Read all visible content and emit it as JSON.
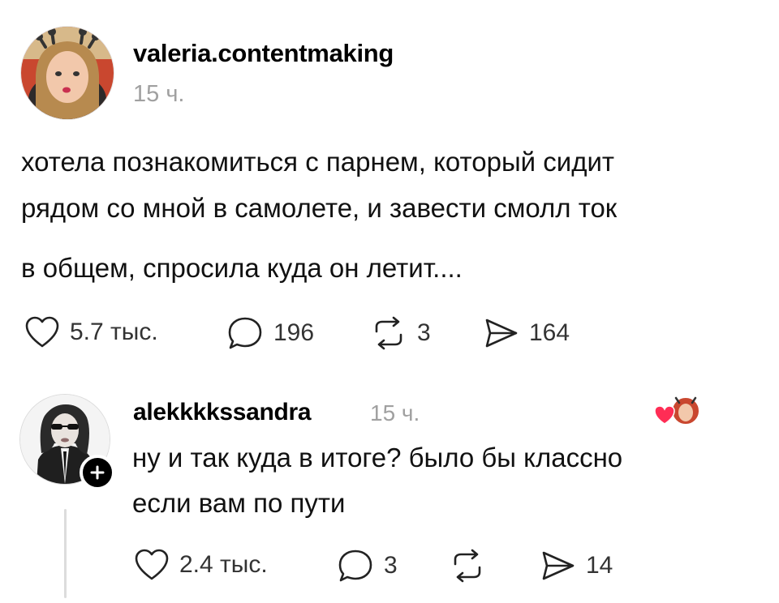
{
  "post": {
    "author": "valeria.contentmaking",
    "time": "15 ч.",
    "lines": [
      "хотела познакомиться с парнем, который сидит",
      "рядом со мной в самолете, и завести смолл ток",
      "в общем, спросила куда он летит...."
    ],
    "stats": {
      "likes": "5.7 тыс.",
      "comments": "196",
      "reposts": "3",
      "shares": "164"
    }
  },
  "reply": {
    "author": "alekkkkssandra",
    "time": "15 ч.",
    "lines": [
      "ну и так куда в итоге? было бы классно",
      "если вам по пути"
    ],
    "stats": {
      "likes": "2.4 тыс.",
      "comments": "3",
      "reposts": "",
      "shares": "14"
    }
  },
  "icons": {
    "like": "heart-outline-icon",
    "comment": "speech-bubble-icon",
    "repost": "repost-arrows-icon",
    "share": "paper-plane-icon",
    "follow": "plus-icon",
    "liked_by_author": "heart-filled-icon"
  },
  "colors": {
    "muted": "#a0a0a0",
    "heart": "#ff2d55",
    "divider": "#dcdcdc"
  }
}
